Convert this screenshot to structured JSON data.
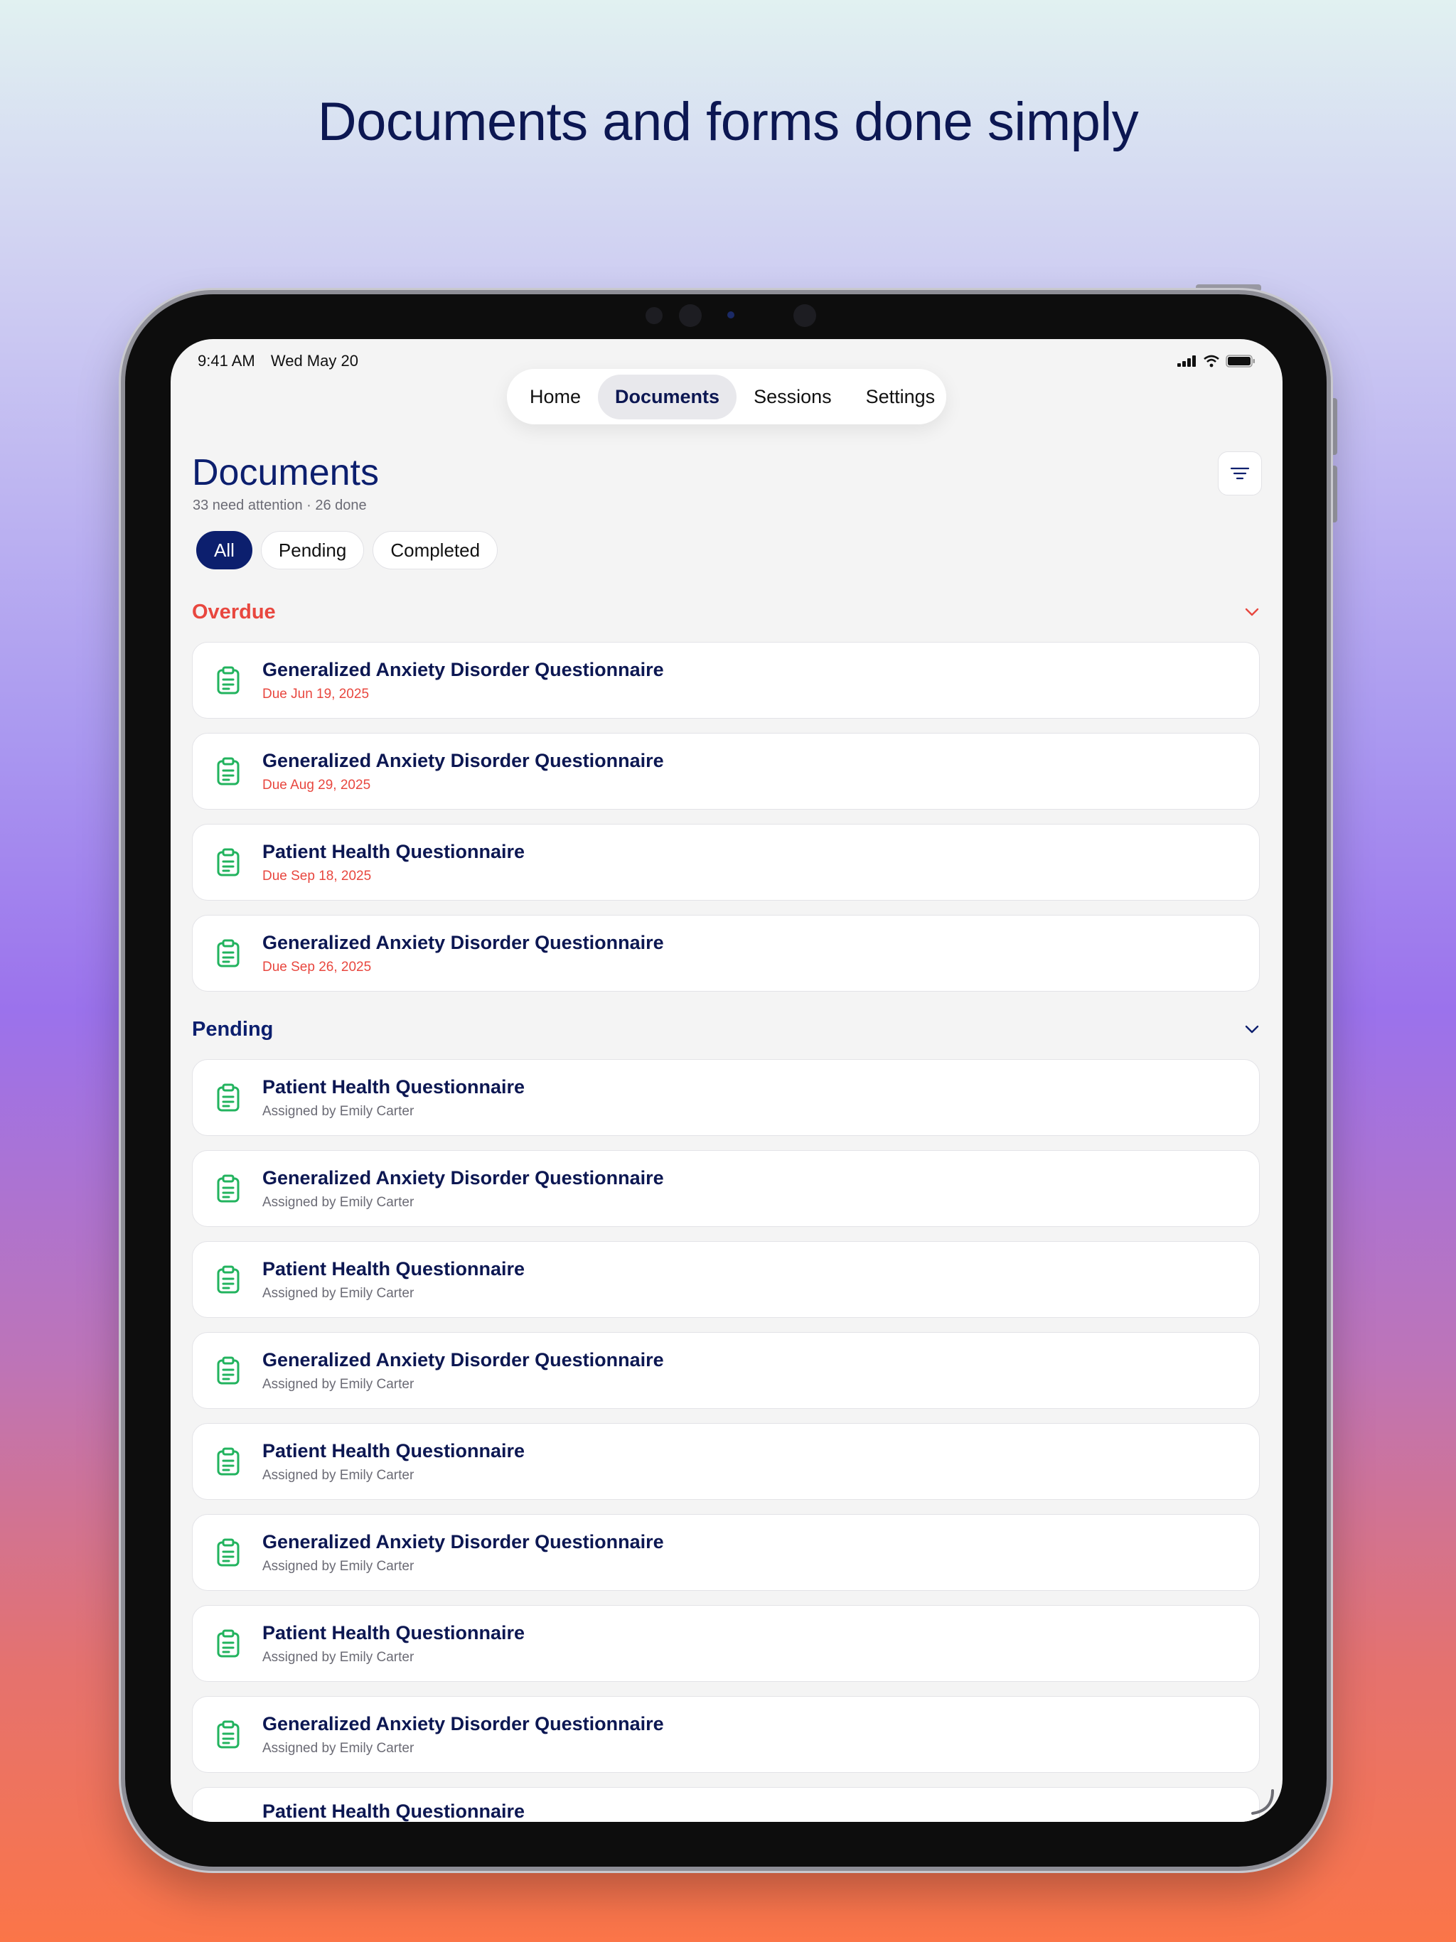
{
  "headline": "Documents and forms done simply",
  "status_bar": {
    "time": "9:41 AM",
    "date": "Wed May 20"
  },
  "nav": {
    "tabs": [
      {
        "label": "Home"
      },
      {
        "label": "Documents"
      },
      {
        "label": "Sessions"
      },
      {
        "label": "Settings"
      }
    ],
    "active": "Documents"
  },
  "page": {
    "title": "Documents",
    "subtitle": "33 need attention · 26 done",
    "filter_icon": "filter-icon"
  },
  "chips": [
    {
      "label": "All"
    },
    {
      "label": "Pending"
    },
    {
      "label": "Completed"
    }
  ],
  "sections": {
    "overdue": {
      "title": "Overdue",
      "color": "#e8473f",
      "items": [
        {
          "title": "Generalized Anxiety Disorder Questionnaire",
          "subtitle": "Due Jun 19, 2025"
        },
        {
          "title": "Generalized Anxiety Disorder Questionnaire",
          "subtitle": "Due Aug 29, 2025"
        },
        {
          "title": "Patient Health Questionnaire",
          "subtitle": "Due Sep 18, 2025"
        },
        {
          "title": "Generalized Anxiety Disorder Questionnaire",
          "subtitle": "Due Sep 26, 2025"
        }
      ]
    },
    "pending": {
      "title": "Pending",
      "color": "#0c1f6e",
      "items": [
        {
          "title": "Patient Health Questionnaire",
          "subtitle": "Assigned by Emily Carter"
        },
        {
          "title": "Generalized Anxiety Disorder Questionnaire",
          "subtitle": "Assigned by Emily Carter"
        },
        {
          "title": "Patient Health Questionnaire",
          "subtitle": "Assigned by Emily Carter"
        },
        {
          "title": "Generalized Anxiety Disorder Questionnaire",
          "subtitle": "Assigned by Emily Carter"
        },
        {
          "title": "Patient Health Questionnaire",
          "subtitle": "Assigned by Emily Carter"
        },
        {
          "title": "Generalized Anxiety Disorder Questionnaire",
          "subtitle": "Assigned by Emily Carter"
        },
        {
          "title": "Patient Health Questionnaire",
          "subtitle": "Assigned by Emily Carter"
        },
        {
          "title": "Generalized Anxiety Disorder Questionnaire",
          "subtitle": "Assigned by Emily Carter"
        },
        {
          "title": "Patient Health Questionnaire",
          "subtitle": ""
        }
      ]
    }
  },
  "colors": {
    "icon_green": "#22b35e",
    "brand_navy": "#0c1f6e"
  }
}
